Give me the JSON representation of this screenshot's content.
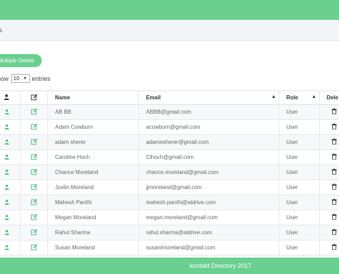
{
  "crumb": {
    "text": "s"
  },
  "actions": {
    "multiple_delete": "Multiple Delete"
  },
  "length": {
    "show": "how",
    "value": "10",
    "entries": "entries"
  },
  "table": {
    "headers": {
      "name": "Name",
      "email": "Email",
      "role": "Role",
      "delete": "Dele"
    },
    "rows": [
      {
        "name": "AB BB",
        "email": "ABBB@gmail.com",
        "role": "User"
      },
      {
        "name": "Adam Cowburn",
        "email": "acowburn@gmail.com",
        "role": "User"
      },
      {
        "name": "adam sherer",
        "email": "adamesherer@gmail.com",
        "role": "User"
      },
      {
        "name": "Caroline Hoch",
        "email": "Clhoch@gmail.com",
        "role": "User"
      },
      {
        "name": "Chance Moreland",
        "email": "chance.moreland@gmail.com",
        "role": "User"
      },
      {
        "name": "Justin Moreland",
        "email": "jjmoreland@gmail.com",
        "role": "User"
      },
      {
        "name": "Mahesh Panthi",
        "email": "mahesh.panthi@atdrive.com",
        "role": "User"
      },
      {
        "name": "Megan Moreland",
        "email": "megan.moreland@gmail.com",
        "role": "User"
      },
      {
        "name": "Rahul Sharma",
        "email": "rahul.sharma@atdrive.com",
        "role": "User"
      },
      {
        "name": "Susan Moreland",
        "email": "susanlmoreland@gmail.com",
        "role": "User"
      }
    ]
  },
  "footer": {
    "text": "kontakt Directory 2017"
  },
  "colors": {
    "brand": "#6bcf90",
    "icon_green": "#4cbb7a"
  }
}
